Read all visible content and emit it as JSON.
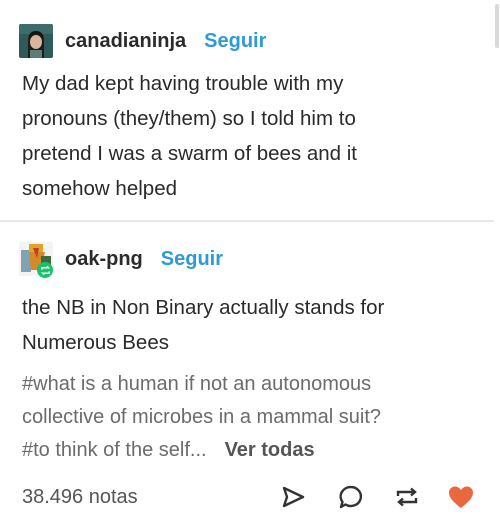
{
  "post1": {
    "username": "canadianinja",
    "follow_label": "Seguir",
    "text_lines": [
      "My dad kept having trouble with my",
      "pronouns (they/them) so I told him to",
      "pretend I was a swarm of bees and it",
      "somehow helped"
    ]
  },
  "post2": {
    "username": "oak-png",
    "follow_label": "Seguir",
    "text_lines": [
      "the NB in Non Binary actually stands for",
      "Numerous Bees"
    ],
    "tag_lines": [
      "#what is a human if not an autonomous",
      "collective of microbes in a mammal suit?",
      "#to think of the self..."
    ],
    "see_all_label": "Ver todas"
  },
  "footer": {
    "notes_label": "38.496 notas",
    "icons": [
      "share-icon",
      "reply-icon",
      "reblog-icon",
      "like-icon"
    ],
    "like_color": "#e8683f",
    "icon_color": "#333333"
  },
  "colors": {
    "follow": "#2e9ad6",
    "reblog_badge": "#19c26b"
  }
}
